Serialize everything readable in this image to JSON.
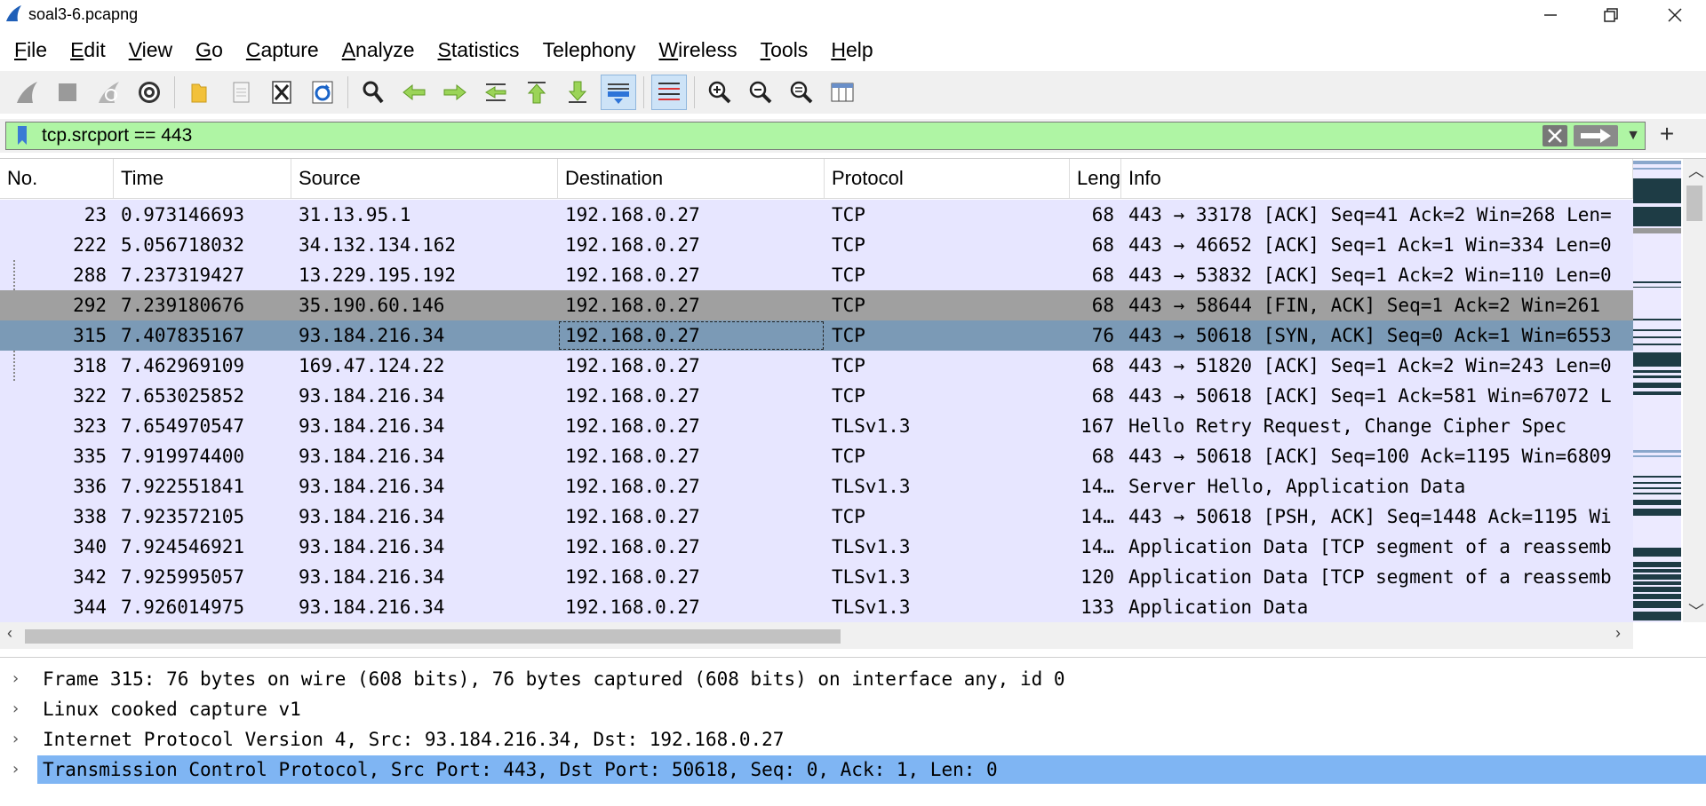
{
  "window": {
    "title": "soal3-6.pcapng"
  },
  "menu": [
    {
      "label": "File",
      "accel": "F",
      "rest": "ile"
    },
    {
      "label": "Edit",
      "accel": "E",
      "rest": "dit"
    },
    {
      "label": "View",
      "accel": "V",
      "rest": "iew"
    },
    {
      "label": "Go",
      "accel": "G",
      "rest": "o"
    },
    {
      "label": "Capture",
      "accel": "C",
      "rest": "apture"
    },
    {
      "label": "Analyze",
      "accel": "A",
      "rest": "nalyze"
    },
    {
      "label": "Statistics",
      "accel": "S",
      "rest": "tatistics"
    },
    {
      "label": "Telephony",
      "accel": "",
      "rest": "Telephony"
    },
    {
      "label": "Wireless",
      "accel": "W",
      "rest": "ireless"
    },
    {
      "label": "Tools",
      "accel": "T",
      "rest": "ools"
    },
    {
      "label": "Help",
      "accel": "H",
      "rest": "elp"
    }
  ],
  "filter": {
    "value": "tcp.srcport == 443",
    "color": "#aff5a4"
  },
  "columns": [
    "No.",
    "Time",
    "Source",
    "Destination",
    "Protocol",
    "Leng",
    "Info"
  ],
  "packets": [
    {
      "no": "23",
      "time": "0.973146693",
      "src": "31.13.95.1",
      "dst": "192.168.0.27",
      "proto": "TCP",
      "len": "68",
      "info": "443 → 33178 [ACK] Seq=41 Ack=2 Win=268 Len=",
      "style": "normal",
      "rel": false
    },
    {
      "no": "222",
      "time": "5.056718032",
      "src": "34.132.134.162",
      "dst": "192.168.0.27",
      "proto": "TCP",
      "len": "68",
      "info": "443 → 46652 [ACK] Seq=1 Ack=1 Win=334 Len=0",
      "style": "normal",
      "rel": false
    },
    {
      "no": "288",
      "time": "7.237319427",
      "src": "13.229.195.192",
      "dst": "192.168.0.27",
      "proto": "TCP",
      "len": "68",
      "info": "443 → 53832 [ACK] Seq=1 Ack=2 Win=110 Len=0",
      "style": "normal",
      "rel": true
    },
    {
      "no": "292",
      "time": "7.239180676",
      "src": "35.190.60.146",
      "dst": "192.168.0.27",
      "proto": "TCP",
      "len": "68",
      "info": "443 → 58644 [FIN, ACK] Seq=1 Ack=2 Win=261",
      "style": "gray",
      "rel": false
    },
    {
      "no": "315",
      "time": "7.407835167",
      "src": "93.184.216.34",
      "dst": "192.168.0.27",
      "proto": "TCP",
      "len": "76",
      "info": "443 → 50618 [SYN, ACK] Seq=0 Ack=1 Win=6553",
      "style": "selected",
      "rel": false
    },
    {
      "no": "318",
      "time": "7.462969109",
      "src": "169.47.124.22",
      "dst": "192.168.0.27",
      "proto": "TCP",
      "len": "68",
      "info": "443 → 51820 [ACK] Seq=1 Ack=2 Win=243 Len=0",
      "style": "normal",
      "rel": true
    },
    {
      "no": "322",
      "time": "7.653025852",
      "src": "93.184.216.34",
      "dst": "192.168.0.27",
      "proto": "TCP",
      "len": "68",
      "info": "443 → 50618 [ACK] Seq=1 Ack=581 Win=67072 L",
      "style": "normal",
      "rel": false
    },
    {
      "no": "323",
      "time": "7.654970547",
      "src": "93.184.216.34",
      "dst": "192.168.0.27",
      "proto": "TLSv1.3",
      "len": "167",
      "info": "Hello Retry Request, Change Cipher Spec",
      "style": "normal",
      "rel": false
    },
    {
      "no": "335",
      "time": "7.919974400",
      "src": "93.184.216.34",
      "dst": "192.168.0.27",
      "proto": "TCP",
      "len": "68",
      "info": "443 → 50618 [ACK] Seq=100 Ack=1195 Win=6809",
      "style": "normal",
      "rel": false
    },
    {
      "no": "336",
      "time": "7.922551841",
      "src": "93.184.216.34",
      "dst": "192.168.0.27",
      "proto": "TLSv1.3",
      "len": "14…",
      "info": "Server Hello, Application Data",
      "style": "normal",
      "rel": false
    },
    {
      "no": "338",
      "time": "7.923572105",
      "src": "93.184.216.34",
      "dst": "192.168.0.27",
      "proto": "TCP",
      "len": "14…",
      "info": "443 → 50618 [PSH, ACK] Seq=1448 Ack=1195 Wi",
      "style": "normal",
      "rel": false
    },
    {
      "no": "340",
      "time": "7.924546921",
      "src": "93.184.216.34",
      "dst": "192.168.0.27",
      "proto": "TLSv1.3",
      "len": "14…",
      "info": "Application Data [TCP segment of a reassemb",
      "style": "normal",
      "rel": false
    },
    {
      "no": "342",
      "time": "7.925995057",
      "src": "93.184.216.34",
      "dst": "192.168.0.27",
      "proto": "TLSv1.3",
      "len": "120",
      "info": "Application Data [TCP segment of a reassemb",
      "style": "normal",
      "rel": false
    },
    {
      "no": "344",
      "time": "7.926014975",
      "src": "93.184.216.34",
      "dst": "192.168.0.27",
      "proto": "TLSv1.3",
      "len": "133",
      "info": "Application Data",
      "style": "normal",
      "rel": false
    }
  ],
  "details": [
    {
      "text": "Frame 315: 76 bytes on wire (608 bits), 76 bytes captured (608 bits) on interface any, id 0",
      "selected": false
    },
    {
      "text": "Linux cooked capture v1",
      "selected": false
    },
    {
      "text": "Internet Protocol Version 4, Src: 93.184.216.34, Dst: 192.168.0.27",
      "selected": false
    },
    {
      "text": "Transmission Control Protocol, Src Port: 443, Dst Port: 50618, Seq: 0, Ack: 1, Len: 0",
      "selected": true
    }
  ],
  "colors": {
    "row_normal": "#e7e6ff",
    "row_gray": "#a0a0a0",
    "row_selected": "#7b9ab6",
    "detail_selected": "#7fb5f3"
  }
}
